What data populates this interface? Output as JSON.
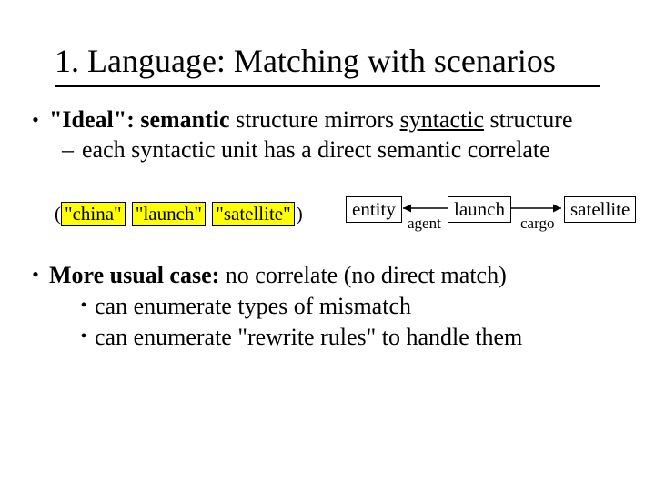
{
  "title": "1. Language: Matching with scenarios",
  "bullet1": {
    "prefix_bold": "\"Ideal\": semantic",
    "mid": " structure mirrors ",
    "underline": "syntactic",
    "suffix": " structure",
    "sub": "each syntactic unit has a direct semantic correlate"
  },
  "example": {
    "open": "(",
    "t1": "\"china\"",
    "t2": "\"launch\"",
    "t3": "\"satellite\"",
    "close": ")"
  },
  "diagram": {
    "entity": "entity",
    "role1": "agent",
    "launch": "launch",
    "role2": "cargo",
    "satellite": "satellite"
  },
  "bullet2": {
    "prefix_bold": "More usual case:",
    "rest": " no correlate (no direct match)",
    "sub1": "can enumerate types of mismatch",
    "sub2": "can enumerate \"rewrite rules\" to handle them"
  }
}
